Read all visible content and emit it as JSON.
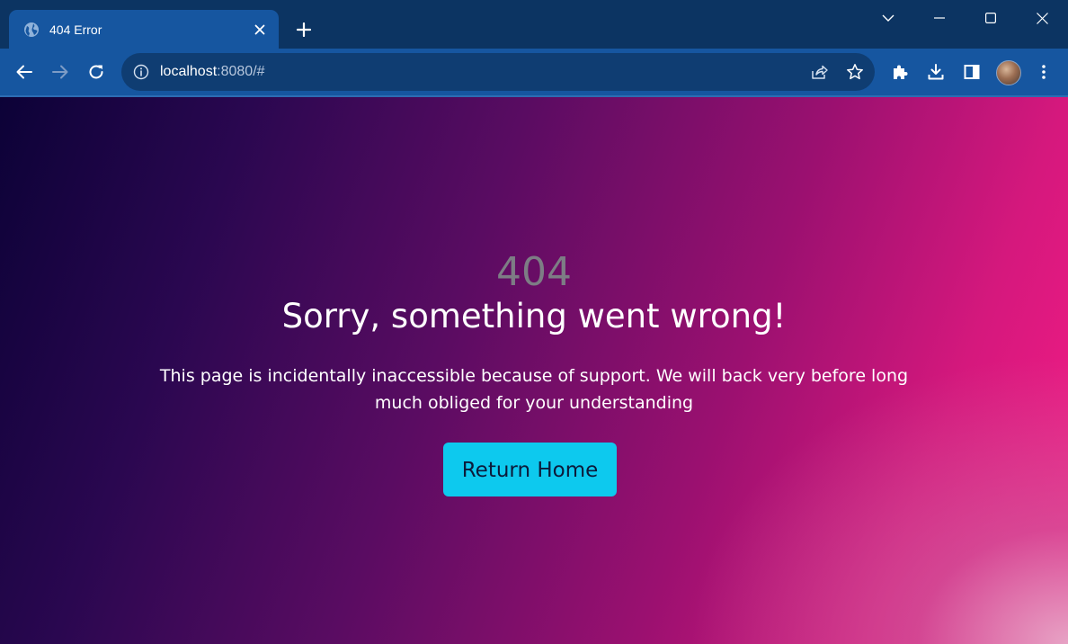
{
  "browser": {
    "tab": {
      "title": "404 Error",
      "favicon": "globe-icon"
    },
    "new_tab_icon": "plus-icon",
    "window_controls": [
      "tab-search-chevron-icon",
      "minimize-icon",
      "maximize-icon",
      "close-icon"
    ],
    "toolbar": {
      "back_icon": "back-arrow-icon",
      "forward_icon": "forward-arrow-icon",
      "reload_icon": "reload-icon",
      "url_host": "localhost",
      "url_rest": ":8080/#",
      "site_info_icon": "info-icon",
      "share_icon": "share-icon",
      "bookmark_icon": "star-icon",
      "extensions_icon": "puzzle-icon",
      "download_icon": "download-icon",
      "side_panel_icon": "side-panel-icon",
      "menu_icon": "kebab-menu-icon"
    },
    "colors": {
      "tabstrip": "#0c3462",
      "toolbar": "#1656a0",
      "omnibox": "#0f3d72"
    }
  },
  "page": {
    "error_code": "404",
    "headline": "Sorry, something went wrong!",
    "message": "This page is incidentally inaccessible because of support. We will back very before long much obliged for your understanding",
    "button_label": "Return Home",
    "colors": {
      "button": "#0dc9ee",
      "gradient_start": "#0c0237",
      "gradient_end": "#f71c86",
      "error_code_text": "#7d7d85"
    }
  }
}
